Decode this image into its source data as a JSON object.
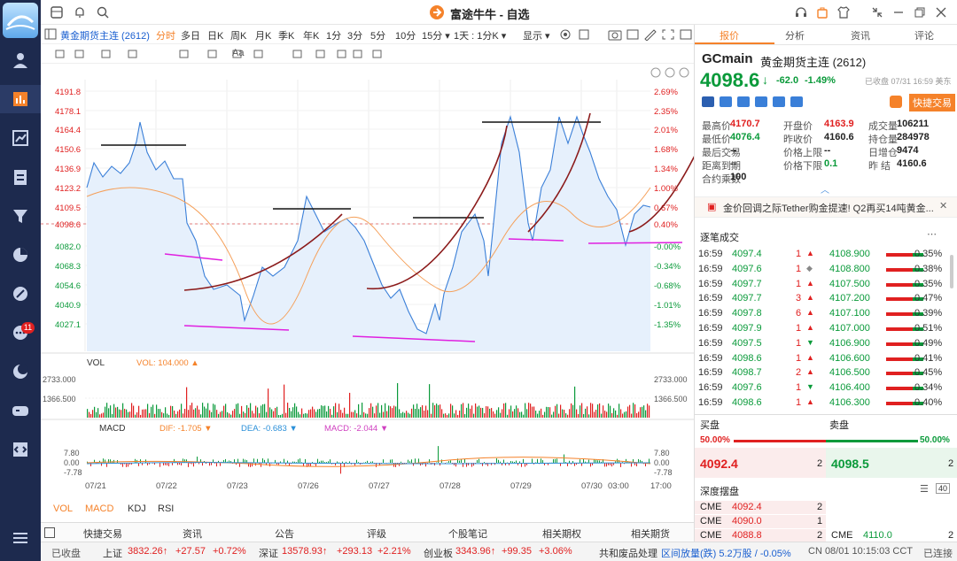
{
  "app": {
    "title": "富途牛牛 - 自选"
  },
  "sidebar": {
    "badge": "11",
    "icons": [
      "user-icon",
      "chart-bar-icon",
      "trend-icon",
      "report-icon",
      "filter-icon",
      "pie-icon",
      "discount-icon",
      "chat-icon",
      "moon-icon",
      "game-icon",
      "code-icon",
      "menu-icon"
    ]
  },
  "toolbar": {
    "instrument": "黄金期货主连 (2612)",
    "periods": [
      "分时",
      "多日",
      "日K",
      "周K",
      "月K",
      "季K",
      "年K",
      "1分",
      "3分",
      "5分",
      "10分",
      "15分 ▾",
      "1天 : 1分K ▾",
      "显示 ▾"
    ]
  },
  "chart": {
    "price_ticks": [
      "4191.8",
      "4178.1",
      "4164.4",
      "4150.6",
      "4136.9",
      "4123.2",
      "4109.5",
      "4098.6",
      "4082.0",
      "4068.3",
      "4054.6",
      "4040.9",
      "4027.1"
    ],
    "pct_ticks": [
      "2.69%",
      "2.35%",
      "2.01%",
      "1.68%",
      "1.34%",
      "1.00%",
      "0.67%",
      "0.40%",
      "-0.00%",
      "-0.34%",
      "-0.68%",
      "-1.01%",
      "-1.35%"
    ],
    "vol_label": "VOL",
    "vol_value": "VOL: 104.000 ▲",
    "vol_ticks": [
      "2733.000",
      "1366.500"
    ],
    "macd_label": "MACD",
    "dif": "DIF: -1.705 ▼",
    "dea": "DEA: -0.683 ▼",
    "macd_val": "MACD: -2.044 ▼",
    "macd_ticks": [
      "7.80",
      "0.00",
      "-7.78"
    ],
    "dates": [
      "07/21",
      "07/22",
      "07/23",
      "07/26",
      "07/27",
      "07/28",
      "07/29",
      "07/30",
      "03:00",
      "17:00"
    ],
    "indicator_tabs": [
      "VOL",
      "MACD",
      "KDJ",
      "RSI"
    ]
  },
  "right": {
    "tabs": [
      "报价",
      "分析",
      "资讯",
      "评论"
    ],
    "symbol": "GCmain",
    "name": "黄金期货主连 (2612)",
    "price": "4098.6",
    "arrow": "↓",
    "change": "-62.0",
    "pct": "-1.49%",
    "closed": "已收盘 07/31 16:59 美东",
    "quick_trade": "快捷交易",
    "stats": [
      [
        "最高价",
        "4170.7",
        "开盘价",
        "4163.9",
        "成交量",
        "106211"
      ],
      [
        "最低价",
        "4076.4",
        "昨收价",
        "4160.6",
        "持仓量",
        "284978"
      ],
      [
        "最后交易",
        "--",
        "价格上限",
        "--",
        "日增仓",
        "9474"
      ],
      [
        "距离到期",
        "--",
        "价格下限",
        "0.1",
        "昨 结",
        "4160.6"
      ],
      [
        "合约乘数",
        "100",
        "",
        "",
        "",
        ""
      ]
    ],
    "news": "金价回调之际Tether购金提速! Q2再买14吨黄金...",
    "trades_title": "逐笔成交",
    "trades_left": [
      [
        "16:59",
        "4097.4",
        "1",
        "▲"
      ],
      [
        "16:59",
        "4097.6",
        "1",
        "◆"
      ],
      [
        "16:59",
        "4097.7",
        "1",
        "▲"
      ],
      [
        "16:59",
        "4097.7",
        "3",
        "▲"
      ],
      [
        "16:59",
        "4097.8",
        "6",
        "▲"
      ],
      [
        "16:59",
        "4097.9",
        "1",
        "▲"
      ],
      [
        "16:59",
        "4097.5",
        "1",
        "▼"
      ],
      [
        "16:59",
        "4098.6",
        "1",
        "▲"
      ],
      [
        "16:59",
        "4098.7",
        "2",
        "▲"
      ],
      [
        "16:59",
        "4097.6",
        "1",
        "▼"
      ],
      [
        "16:59",
        "4098.6",
        "1",
        "▲"
      ]
    ],
    "trades_right": [
      [
        "4108.900",
        "0.35%"
      ],
      [
        "4108.800",
        "0.38%"
      ],
      [
        "4107.500",
        "0.35%"
      ],
      [
        "4107.200",
        "0.47%"
      ],
      [
        "4107.100",
        "0.39%"
      ],
      [
        "4107.000",
        "0.51%"
      ],
      [
        "4106.900",
        "0.49%"
      ],
      [
        "4106.600",
        "0.41%"
      ],
      [
        "4106.500",
        "0.45%"
      ],
      [
        "4106.400",
        "0.34%"
      ],
      [
        "4106.300",
        "0.40%"
      ]
    ],
    "bid_label": "买盘",
    "ask_label": "卖盘",
    "bid_pct": "50.00%",
    "ask_pct": "50.00%",
    "bid_price": "4092.4",
    "bid_qty": "2",
    "ask_price": "4098.5",
    "ask_qty": "2",
    "depth_title": "深度摆盘",
    "depth_count": "40",
    "depth": [
      [
        "CME",
        "4092.4",
        "2"
      ],
      [
        "CME",
        "4090.0",
        "1"
      ],
      [
        "CME",
        "4088.8",
        "2"
      ]
    ],
    "depth_right": [
      [
        "CME",
        "4110.0",
        "2"
      ]
    ]
  },
  "bottom_tabs": [
    "快捷交易",
    "资讯",
    "公告",
    "评级",
    "个股笔记",
    "相关期权",
    "相关期货"
  ],
  "status": {
    "closed": "已收盘",
    "sh": "上证",
    "sh_val": "3832.26↑",
    "sh_chg": "+27.57",
    "sh_pct": "+0.72%",
    "sz": "深证",
    "sz_val": "13578.93↑",
    "sz_chg": "+293.13",
    "sz_pct": "+2.21%",
    "cy": "创业板",
    "cy_val": "3343.96↑",
    "cy_chg": "+99.35",
    "cy_pct": "+3.06%",
    "news": "共和废品处理",
    "range": "区间放量(跌) 5.2万股 / -0.05%",
    "time": "CN 08/01 10:15:03 CCT",
    "conn": "已连接"
  }
}
